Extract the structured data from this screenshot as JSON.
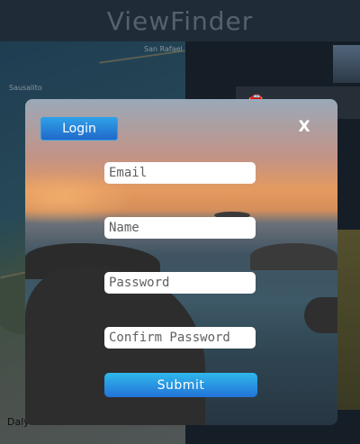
{
  "app": {
    "title": "ViewFinder",
    "map_labels": [
      "San Rafael",
      "Sausalito",
      "Daly"
    ]
  },
  "modal": {
    "tab_label": "Login",
    "close_label": "X",
    "fields": {
      "email_placeholder": "Email",
      "name_placeholder": "Name",
      "password_placeholder": "Password",
      "confirm_placeholder": "Confirm Password"
    },
    "submit_label": "Submit"
  },
  "colors": {
    "primary_button": "#2273d8",
    "header_bg": "#1f2c38",
    "title_text": "#56616b"
  },
  "icons": {
    "close": "close-icon",
    "car": "car-icon"
  }
}
